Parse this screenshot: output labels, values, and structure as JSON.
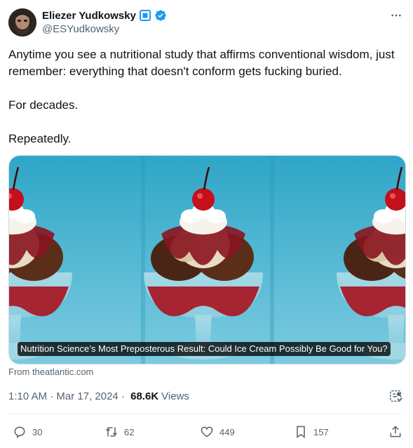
{
  "author": {
    "name": "Eliezer Yudkowsky",
    "handle": "@ESYudkowsky"
  },
  "tweet": {
    "text": "Anytime you see a nutritional study that affirms conventional wisdom, just remember: everything that doesn't conform gets fucking buried.\n\nFor decades.\n\nRepeatedly."
  },
  "card": {
    "caption": "Nutrition Science’s Most Preposterous Result: Could Ice Cream Possibly Be Good for You?",
    "source": "From theatlantic.com"
  },
  "meta": {
    "time": "1:10 AM",
    "separator1": " · ",
    "date": "Mar 17, 2024",
    "separator2": " · ",
    "views_count": "68.6K",
    "views_label": "Views"
  },
  "actions": {
    "replies": "30",
    "reposts": "62",
    "likes": "449",
    "bookmarks": "157"
  },
  "colors": {
    "verified": "#1d9bf0",
    "text_secondary": "#536471",
    "card_background": "#3aa8c9"
  }
}
